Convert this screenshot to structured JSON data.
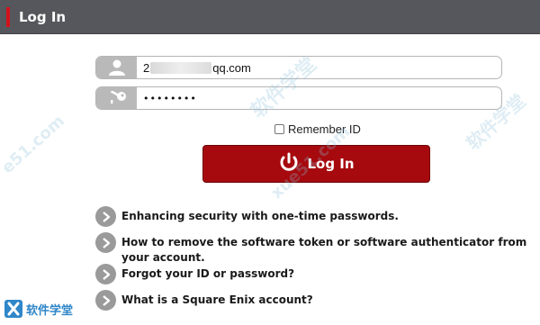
{
  "header": {
    "title": "Log In"
  },
  "form": {
    "email_prefix": "2",
    "email_suffix": "qq.com",
    "password_mask": "••••••••",
    "remember_label": "Remember ID",
    "remember_checked": false,
    "login_label": "Log In"
  },
  "links": [
    {
      "text": "Enhancing security with one-time passwords."
    },
    {
      "text": "How to remove the software token or software authenticator from your account."
    },
    {
      "text": "Forgot your ID or password?"
    },
    {
      "text": "What is a Square Enix account?"
    }
  ],
  "watermark": {
    "logo_text": "软件学堂",
    "diag_1": "软件学堂",
    "diag_2": "xue51.com",
    "diag_3": "e51.com"
  },
  "colors": {
    "header_bg": "#55575c",
    "accent_red": "#d4121a",
    "button_red": "#a60a0e",
    "icon_gray": "#b9b9b9",
    "chevron_gray": "#9a9a9a"
  },
  "icons": {
    "user": "user-icon",
    "key": "key-icon",
    "power": "power-icon",
    "chevron": "chevron-right-icon"
  }
}
